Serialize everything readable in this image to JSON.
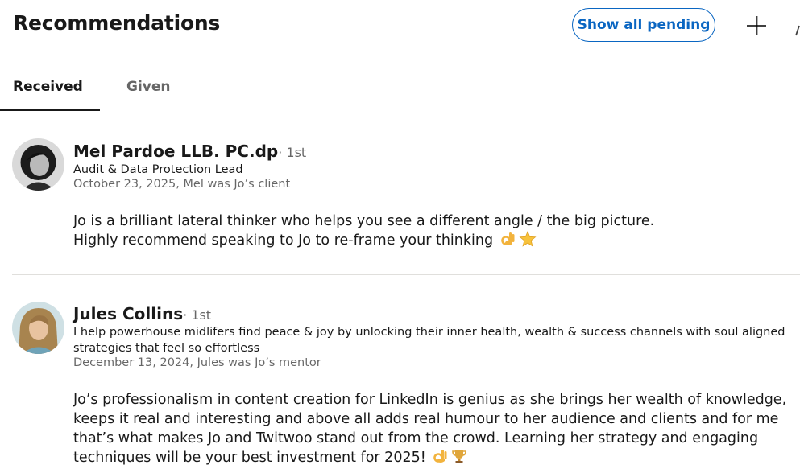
{
  "header": {
    "title": "Recommendations",
    "show_all_pending_label": "Show all pending",
    "add_icon": "plus-icon"
  },
  "tabs": [
    {
      "label": "Received",
      "active": true
    },
    {
      "label": "Given",
      "active": false
    }
  ],
  "recommendations": [
    {
      "name": "Mel Pardoe  LLB. PC.dp",
      "degree": "· 1st",
      "headline": "Audit & Data Protection Lead",
      "meta": "October 23, 2025, Mel was Jo’s client",
      "text_lines": [
        "Jo is a brilliant lateral thinker who helps you see a different angle / the big picture.",
        "Highly recommend speaking to Jo to re-frame your thinking"
      ],
      "emojis": [
        "ok-hand-icon",
        "star-icon"
      ]
    },
    {
      "name": "Jules Collins",
      "degree": "· 1st",
      "headline": "I help powerhouse midlifers find peace & joy by unlocking their inner health, wealth & success channels with soul aligned strategies that feel so effortless",
      "meta": "December 13, 2024, Jules was Jo’s mentor",
      "text": "Jo’s professionalism in content creation for LinkedIn is genius as she brings her wealth of knowledge, keeps it real and interesting and above all adds real humour to her audience and clients and for me that’s what makes Jo and Twitwoo stand out from the crowd.  Learning her strategy and engaging techniques will be your best investment for 2025!",
      "emojis": [
        "ok-hand-icon",
        "trophy-icon"
      ]
    }
  ],
  "colors": {
    "accent": "#0a66c2",
    "divider": "#e0dfdc"
  }
}
